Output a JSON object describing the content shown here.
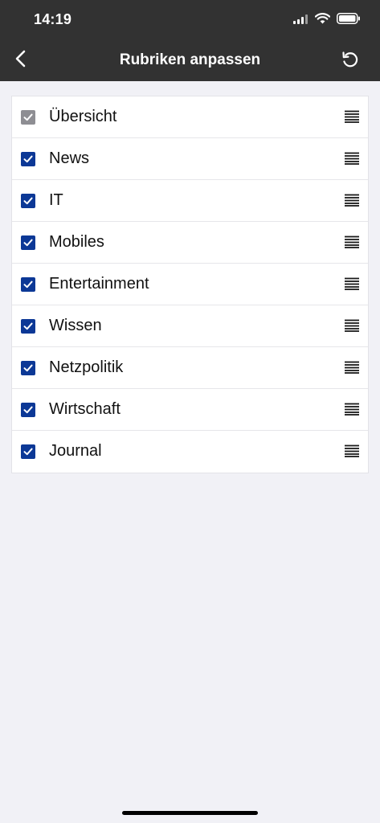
{
  "status_bar": {
    "time": "14:19",
    "icons": [
      "cellular-signal-icon",
      "wifi-icon",
      "battery-icon"
    ]
  },
  "nav": {
    "title": "Rubriken anpassen",
    "back_icon": "chevron-left-icon",
    "reset_icon": "reset-icon"
  },
  "colors": {
    "header_bg": "#323232",
    "checkbox_checked": "#0c3896",
    "checkbox_disabled": "#8e8e93",
    "page_bg": "#f1f1f6"
  },
  "sections": [
    {
      "label": "Übersicht",
      "checked": true,
      "disabled": true
    },
    {
      "label": "News",
      "checked": true,
      "disabled": false
    },
    {
      "label": "IT",
      "checked": true,
      "disabled": false
    },
    {
      "label": "Mobiles",
      "checked": true,
      "disabled": false
    },
    {
      "label": "Entertainment",
      "checked": true,
      "disabled": false
    },
    {
      "label": "Wissen",
      "checked": true,
      "disabled": false
    },
    {
      "label": "Netzpolitik",
      "checked": true,
      "disabled": false
    },
    {
      "label": "Wirtschaft",
      "checked": true,
      "disabled": false
    },
    {
      "label": "Journal",
      "checked": true,
      "disabled": false
    }
  ]
}
